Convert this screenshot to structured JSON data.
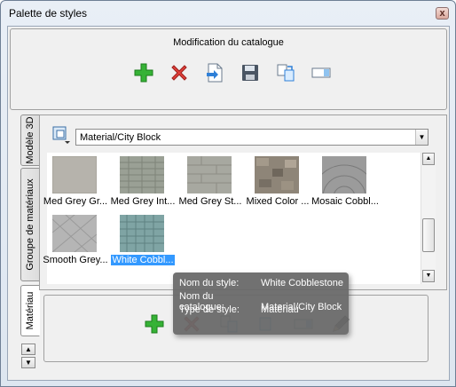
{
  "window": {
    "title": "Palette de styles",
    "close_glyph": "x"
  },
  "catalog_group": {
    "caption": "Modification du catalogue",
    "buttons": [
      {
        "name": "add",
        "icon": "plus-icon"
      },
      {
        "name": "delete",
        "icon": "delete-icon"
      },
      {
        "name": "import",
        "icon": "import-icon"
      },
      {
        "name": "save",
        "icon": "save-icon"
      },
      {
        "name": "copy",
        "icon": "copy-icon"
      },
      {
        "name": "rename",
        "icon": "rename-icon"
      }
    ]
  },
  "tabs": [
    {
      "label": "Modèle 3D"
    },
    {
      "label": "Groupe de matériaux"
    },
    {
      "label": "Matériau"
    }
  ],
  "catalog_select": {
    "value": "Material/City Block"
  },
  "styles": [
    {
      "label": "Med Grey Gr...",
      "color": "#b6b3ac"
    },
    {
      "label": "Med Grey Int...",
      "color": "#9aa095"
    },
    {
      "label": "Med Grey St...",
      "color": "#a7a8a0"
    },
    {
      "label": "Mixed Color ...",
      "color": "#8e8578"
    },
    {
      "label": "Mosaic Cobbl...",
      "color": "#9b9b9b"
    },
    {
      "label": "Smooth Grey...",
      "color": "#b5b5b5"
    },
    {
      "label": "White Cobbl...",
      "color": "#7fa4a4"
    }
  ],
  "tooltip": {
    "rows": [
      {
        "key": "Nom du style:",
        "value": "White Cobblestone"
      },
      {
        "key": "Nom du catalogue:",
        "value": "Material/City Block"
      },
      {
        "key": "Type de style:",
        "value": "Matériau"
      }
    ]
  },
  "colors": {
    "accent_selection": "#3399ff",
    "add_green": "#2fa82f",
    "delete_red": "#d9302c"
  }
}
